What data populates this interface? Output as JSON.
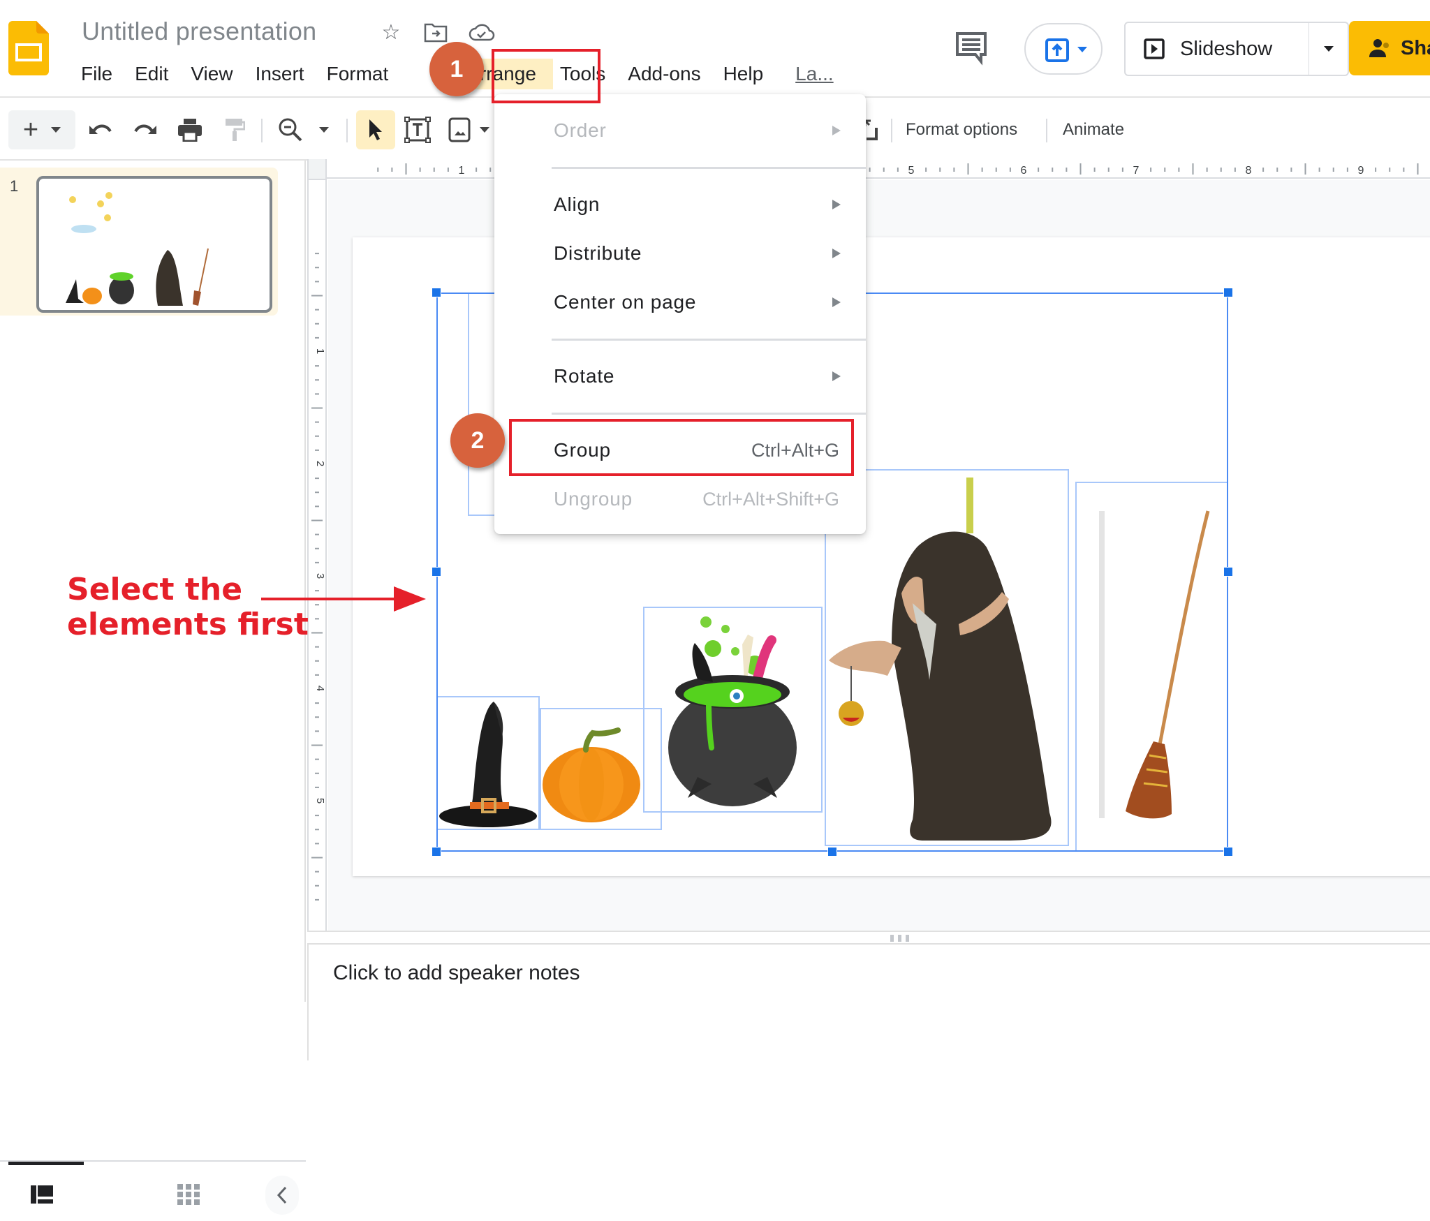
{
  "header": {
    "doc_title": "Untitled presentation",
    "title_icons": [
      "star-icon",
      "move-to-folder-icon",
      "cloud-saved-icon"
    ],
    "menu": [
      "File",
      "Edit",
      "View",
      "Insert",
      "Format",
      "Arrange",
      "Tools",
      "Add-ons",
      "Help",
      "La..."
    ],
    "active_menu": "Arrange",
    "slideshow_label": "Slideshow",
    "share_label": "Sha"
  },
  "toolbar": {
    "format_options_label": "Format options",
    "animate_label": "Animate"
  },
  "rulers": {
    "horizontal_labels": [
      "1",
      "5",
      "6",
      "7",
      "8",
      "9"
    ],
    "vertical_labels": [
      "1",
      "2",
      "3",
      "4",
      "5"
    ]
  },
  "filmstrip": {
    "slide_number": "1"
  },
  "arrange_menu": {
    "items": [
      {
        "label": "Order",
        "submenu": true,
        "disabled": true,
        "shortcut": ""
      },
      {
        "label": "Align",
        "submenu": true,
        "disabled": false,
        "shortcut": ""
      },
      {
        "label": "Distribute",
        "submenu": true,
        "disabled": false,
        "shortcut": ""
      },
      {
        "label": "Center on page",
        "submenu": true,
        "disabled": false,
        "shortcut": ""
      },
      {
        "label": "Rotate",
        "submenu": true,
        "disabled": false,
        "shortcut": ""
      },
      {
        "label": "Group",
        "submenu": false,
        "disabled": false,
        "shortcut": "Ctrl+Alt+G"
      },
      {
        "label": "Ungroup",
        "submenu": false,
        "disabled": true,
        "shortcut": "Ctrl+Alt+Shift+G"
      }
    ]
  },
  "slide_objects": [
    "witch-hat",
    "pumpkin",
    "cauldron",
    "witch",
    "broom",
    "moon-and-stars"
  ],
  "notes": {
    "placeholder": "Click to add speaker notes"
  },
  "annotations": {
    "step1": "1",
    "step2": "2",
    "callout_line1": "Select the",
    "callout_line2": "elements first",
    "color": "#e5202a",
    "badge_color": "#d7623d"
  },
  "colors": {
    "selection": "#1a73e8",
    "share_button": "#fbbc04",
    "active_menu_bg": "#feefc3"
  }
}
